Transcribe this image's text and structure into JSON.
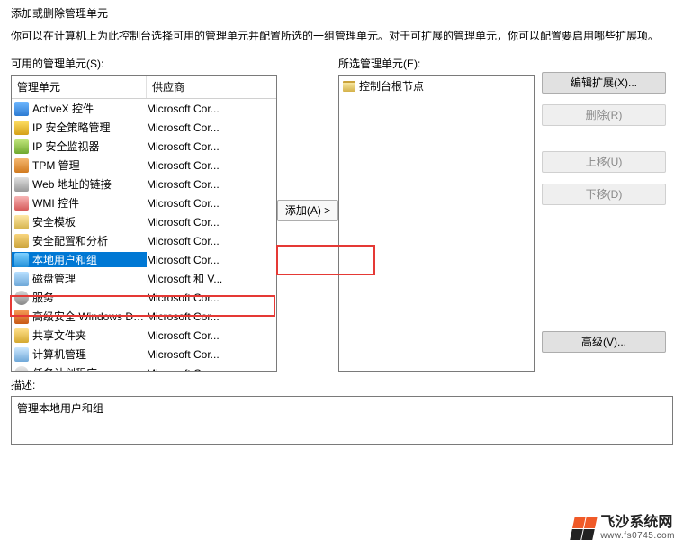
{
  "title": "添加或删除管理单元",
  "subtitle": "你可以在计算机上为此控制台选择可用的管理单元并配置所选的一组管理单元。对于可扩展的管理单元，你可以配置要启用哪些扩展项。",
  "available_label": "可用的管理单元(S):",
  "selected_label": "所选管理单元(E):",
  "header": {
    "name": "管理单元",
    "vendor": "供应商"
  },
  "snapins": [
    {
      "name": "ActiveX 控件",
      "vendor": "Microsoft Cor...",
      "icon": "ic-ax"
    },
    {
      "name": "IP 安全策略管理",
      "vendor": "Microsoft Cor...",
      "icon": "ic-ip1"
    },
    {
      "name": "IP 安全监视器",
      "vendor": "Microsoft Cor...",
      "icon": "ic-ip2"
    },
    {
      "name": "TPM 管理",
      "vendor": "Microsoft Cor...",
      "icon": "ic-tpm"
    },
    {
      "name": "Web 地址的链接",
      "vendor": "Microsoft Cor...",
      "icon": "ic-web"
    },
    {
      "name": "WMI 控件",
      "vendor": "Microsoft Cor...",
      "icon": "ic-wmi"
    },
    {
      "name": "安全模板",
      "vendor": "Microsoft Cor...",
      "icon": "ic-tmpl"
    },
    {
      "name": "安全配置和分析",
      "vendor": "Microsoft Cor...",
      "icon": "ic-seccfg"
    },
    {
      "name": "本地用户和组",
      "vendor": "Microsoft Cor...",
      "icon": "ic-users",
      "selected": true
    },
    {
      "name": "磁盘管理",
      "vendor": "Microsoft 和 V...",
      "icon": "ic-disk"
    },
    {
      "name": "服务",
      "vendor": "Microsoft Cor...",
      "icon": "ic-svc"
    },
    {
      "name": "高级安全 Windows De...",
      "vendor": "Microsoft Cor...",
      "icon": "ic-fw"
    },
    {
      "name": "共享文件夹",
      "vendor": "Microsoft Cor...",
      "icon": "ic-share"
    },
    {
      "name": "计算机管理",
      "vendor": "Microsoft Cor...",
      "icon": "ic-mgmt"
    },
    {
      "name": "任务计划程序",
      "vendor": "Microsoft Cor...",
      "icon": "ic-task"
    }
  ],
  "tree_root": "控制台根节点",
  "buttons": {
    "add": "添加(A) >",
    "edit_ext": "编辑扩展(X)...",
    "remove": "删除(R)",
    "move_up": "上移(U)",
    "move_down": "下移(D)",
    "advanced": "高级(V)..."
  },
  "description_label": "描述:",
  "description_text": "管理本地用户和组",
  "watermark": {
    "main": "飞沙系统网",
    "sub": "www.fs0745.com"
  }
}
